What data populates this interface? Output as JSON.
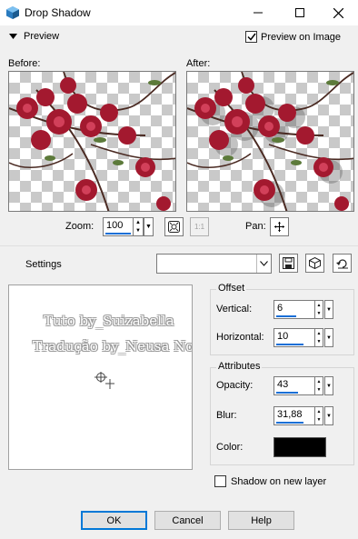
{
  "window": {
    "title": "Drop Shadow"
  },
  "preview": {
    "toggle_label": "Preview",
    "preview_on_image_label": "Preview on Image",
    "preview_on_image_checked": true,
    "before_label": "Before:",
    "after_label": "After:"
  },
  "zoom": {
    "label": "Zoom:",
    "value": "100"
  },
  "pan": {
    "label": "Pan:"
  },
  "settings": {
    "label": "Settings",
    "value": ""
  },
  "watermark": {
    "line1": "Tuto by_Suizabella",
    "line2": "Tradução by_Neusa Novaes"
  },
  "offset": {
    "title": "Offset",
    "vertical_label": "Vertical:",
    "vertical_value": "6",
    "horizontal_label": "Horizontal:",
    "horizontal_value": "10"
  },
  "attributes": {
    "title": "Attributes",
    "opacity_label": "Opacity:",
    "opacity_value": "43",
    "blur_label": "Blur:",
    "blur_value": "31,88",
    "color_label": "Color:",
    "color_value": "#000000"
  },
  "shadow_new_layer": {
    "label": "Shadow on new layer",
    "checked": false
  },
  "buttons": {
    "ok": "OK",
    "cancel": "Cancel",
    "help": "Help"
  }
}
